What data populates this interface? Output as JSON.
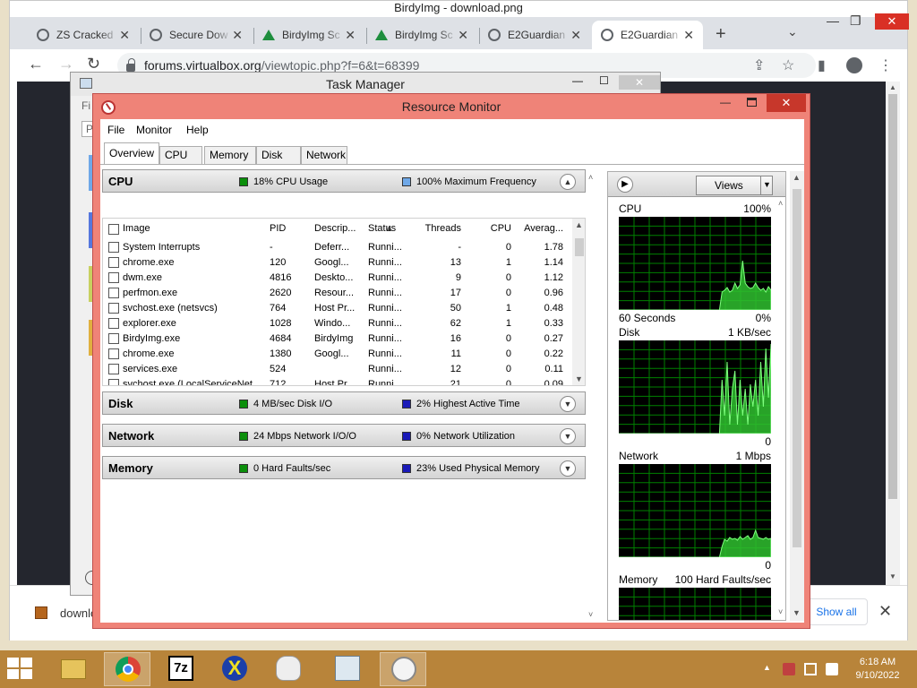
{
  "chrome": {
    "title": "BirdyImg - download.png",
    "tabs": [
      {
        "label": "ZS Cracked",
        "icon": "globe-icon"
      },
      {
        "label": "Secure Dow",
        "icon": "globe-icon"
      },
      {
        "label": "BirdyImg Sc",
        "icon": "drive-icon"
      },
      {
        "label": "BirdyImg Sc",
        "icon": "drive-icon"
      },
      {
        "label": "E2Guardian",
        "icon": "globe-icon"
      },
      {
        "label": "E2Guardian",
        "icon": "globe-icon",
        "active": true
      }
    ],
    "url_host": "forums.virtualbox.org",
    "url_path": "/viewtopic.php?f=6&t=68399",
    "download_name": "downlo",
    "show_all": "Show all"
  },
  "task_manager": {
    "title": "Task Manager",
    "menu_fragment": "Fi",
    "tab_fragment": "Pr"
  },
  "resmon": {
    "title": "Resource Monitor",
    "menu": [
      "File",
      "Monitor",
      "Help"
    ],
    "tabs": [
      "Overview",
      "CPU",
      "Memory",
      "Disk",
      "Network"
    ],
    "active_tab": "Overview",
    "sections": {
      "cpu": {
        "name": "CPU",
        "ind1": "18% CPU Usage",
        "ind1_color": "#0b8f0b",
        "ind2": "100% Maximum Frequency",
        "ind2_color": "#6fa8e8"
      },
      "disk": {
        "name": "Disk",
        "ind1": "4 MB/sec Disk I/O",
        "ind1_color": "#0b8f0b",
        "ind2": "2% Highest Active Time",
        "ind2_color": "#1a1ab8"
      },
      "network": {
        "name": "Network",
        "ind1": "24 Mbps Network I/O/O",
        "ind1_color": "#0b8f0b",
        "ind2": "0% Network Utilization",
        "ind2_color": "#1a1ab8"
      },
      "memory": {
        "name": "Memory",
        "ind1": "0 Hard Faults/sec",
        "ind1_color": "#0b8f0b",
        "ind2": "23% Used Physical Memory",
        "ind2_color": "#1a1ab8"
      }
    },
    "cpu_table": {
      "headers": {
        "image": "Image",
        "pid": "PID",
        "desc": "Descrip...",
        "status": "Status",
        "threads": "Threads",
        "cpu": "CPU",
        "avg": "Averag..."
      },
      "rows": [
        {
          "image": "System Interrupts",
          "pid": "-",
          "desc": "Deferr...",
          "status": "Runni...",
          "threads": "-",
          "cpu": "0",
          "avg": "1.78"
        },
        {
          "image": "chrome.exe",
          "pid": "120",
          "desc": "Googl...",
          "status": "Runni...",
          "threads": "13",
          "cpu": "1",
          "avg": "1.14"
        },
        {
          "image": "dwm.exe",
          "pid": "4816",
          "desc": "Deskto...",
          "status": "Runni...",
          "threads": "9",
          "cpu": "0",
          "avg": "1.12"
        },
        {
          "image": "perfmon.exe",
          "pid": "2620",
          "desc": "Resour...",
          "status": "Runni...",
          "threads": "17",
          "cpu": "0",
          "avg": "0.96"
        },
        {
          "image": "svchost.exe (netsvcs)",
          "pid": "764",
          "desc": "Host Pr...",
          "status": "Runni...",
          "threads": "50",
          "cpu": "1",
          "avg": "0.48"
        },
        {
          "image": "explorer.exe",
          "pid": "1028",
          "desc": "Windo...",
          "status": "Runni...",
          "threads": "62",
          "cpu": "1",
          "avg": "0.33"
        },
        {
          "image": "BirdyImg.exe",
          "pid": "4684",
          "desc": "BirdyImg",
          "status": "Runni...",
          "threads": "16",
          "cpu": "0",
          "avg": "0.27"
        },
        {
          "image": "chrome.exe",
          "pid": "1380",
          "desc": "Googl...",
          "status": "Runni...",
          "threads": "11",
          "cpu": "0",
          "avg": "0.22"
        },
        {
          "image": "services.exe",
          "pid": "524",
          "desc": "",
          "status": "Runni...",
          "threads": "12",
          "cpu": "0",
          "avg": "0.11"
        },
        {
          "image": "svchost.exe (LocalServiceNet...",
          "pid": "712",
          "desc": "Host Pr...",
          "status": "Runni...",
          "threads": "21",
          "cpu": "0",
          "avg": "0.09"
        }
      ]
    },
    "right_pane": {
      "views": "Views",
      "graphs": [
        {
          "label": "CPU",
          "max": "100%",
          "bottom_left": "60 Seconds",
          "bottom_right": "0%"
        },
        {
          "label": "Disk",
          "max": "1 KB/sec",
          "bottom_left": "",
          "bottom_right": "0"
        },
        {
          "label": "Network",
          "max": "1 Mbps",
          "bottom_left": "",
          "bottom_right": "0"
        },
        {
          "label": "Memory",
          "max": "100 Hard Faults/sec",
          "bottom_left": "",
          "bottom_right": ""
        }
      ]
    }
  },
  "taskbar": {
    "apps": [
      "windows-explorer-icon",
      "chrome-icon",
      "7zip-icon",
      "x-app-icon",
      "figure-app-icon",
      "task-manager-icon",
      "resource-monitor-icon"
    ],
    "time": "6:18 AM",
    "date": "9/10/2022"
  }
}
